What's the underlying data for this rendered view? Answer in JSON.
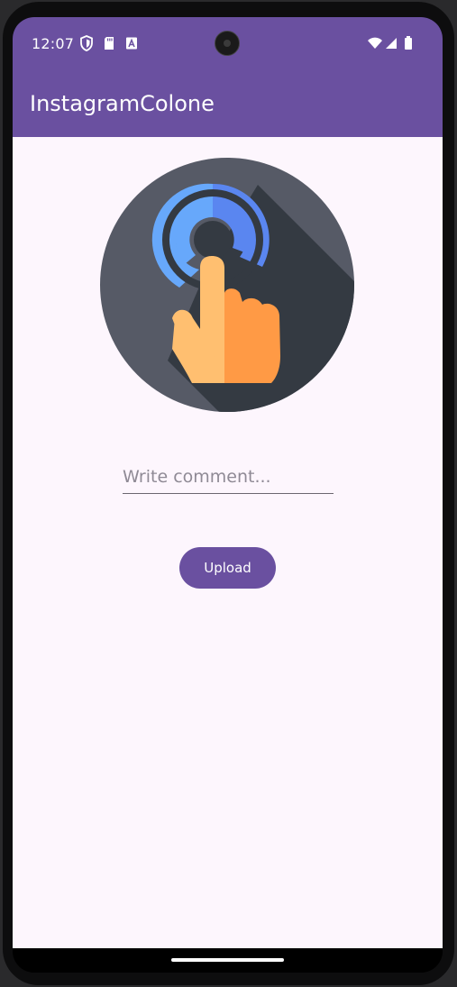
{
  "status_bar": {
    "time": "12:07",
    "left_icons": [
      "shield-icon",
      "sd-card-icon",
      "text-a-icon"
    ],
    "right_icons": [
      "wifi-icon",
      "signal-icon",
      "battery-icon"
    ]
  },
  "app_bar": {
    "title": "InstagramColone",
    "color": "#6a50a0"
  },
  "main": {
    "image": {
      "icon": "touch-tap-icon",
      "colors": [
        "#565a66",
        "#343a42",
        "#5e9cf8",
        "#ffbf70",
        "#ff9a45"
      ]
    },
    "comment_input": {
      "value": "",
      "placeholder": "Write comment..."
    },
    "upload_button": {
      "label": "Upload"
    }
  },
  "colors": {
    "primary": "#6a50a0",
    "background": "#fdf6fd"
  }
}
